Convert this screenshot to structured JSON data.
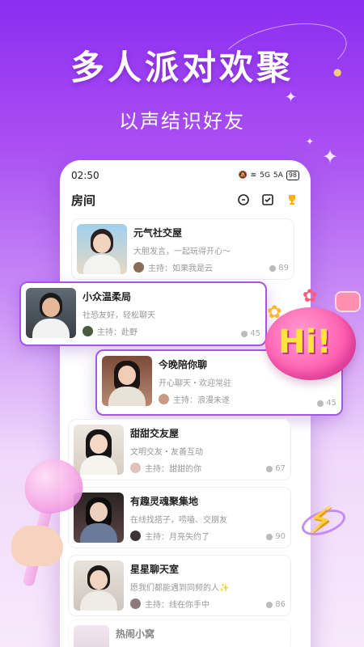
{
  "hero": {
    "title": "多人派对欢聚",
    "subtitle": "以声结识好友"
  },
  "status": {
    "time": "02:50",
    "battery": "98",
    "signal1": "5G",
    "signal2": "5A"
  },
  "header": {
    "title": "房间"
  },
  "rooms": [
    {
      "name": "元气社交屋",
      "desc": "大胆发言，一起玩得开心～",
      "host": "主持：如果我是云",
      "count": "89"
    },
    {
      "name": "小众温柔局",
      "desc": "社恐友好，轻松聊天",
      "host": "主持：赴野",
      "count": "45"
    },
    {
      "name": "今晚陪你聊",
      "desc": "开心聊天・欢迎常驻",
      "host": "主持：浪漫未遂",
      "count": "45"
    },
    {
      "name": "甜甜交友屋",
      "desc": "文明交友・友善互动",
      "host": "主持：甜甜的你",
      "count": "67"
    },
    {
      "name": "有趣灵魂聚集地",
      "desc": "在线找搭子，唠嗑、交朋友",
      "host": "主持：月亮失约了",
      "count": "90"
    },
    {
      "name": "星星聊天室",
      "desc": "愿我们都能遇到同频的人✨",
      "host": "主持：线在你手中",
      "count": "86"
    },
    {
      "name": "热闹小窝",
      "desc": "",
      "host": "",
      "count": ""
    }
  ],
  "sticker": {
    "hi": "Hi!"
  },
  "colors": {
    "accent": "#a456e8",
    "bg_top": "#8b2df0",
    "bg_bottom": "#f7e9fb"
  },
  "icons": [
    "search-icon",
    "checkbox-icon",
    "trophy-icon",
    "user-count-icon"
  ]
}
